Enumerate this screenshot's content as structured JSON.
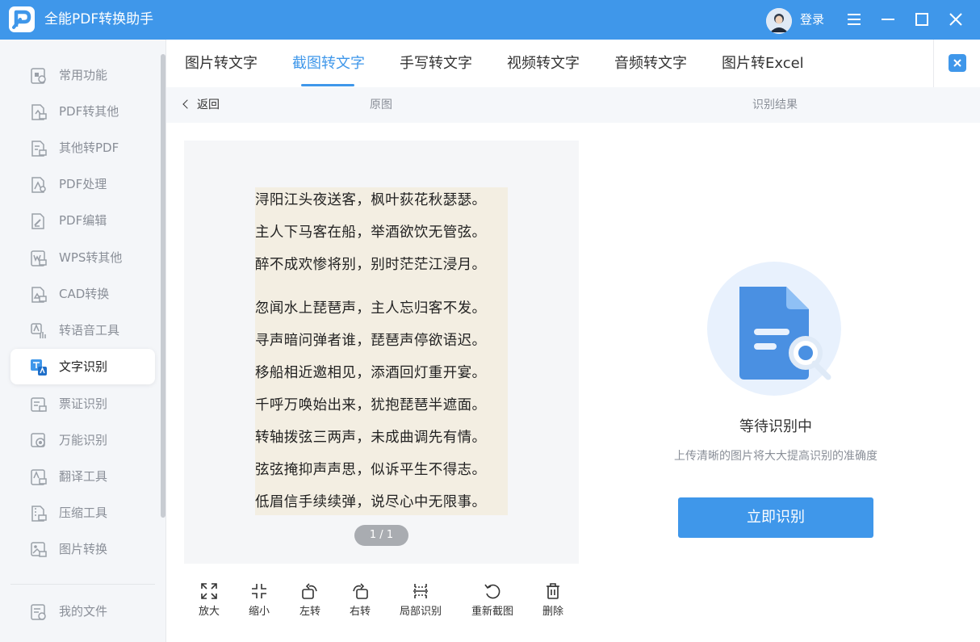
{
  "app": {
    "title": "全能PDF转换助手",
    "login_label": "登录",
    "accent": "#3f97ea"
  },
  "sidebar": {
    "items": [
      {
        "label": "常用功能",
        "icon": "common-icon"
      },
      {
        "label": "PDF转其他",
        "icon": "pdf-convert-icon"
      },
      {
        "label": "其他转PDF",
        "icon": "to-pdf-icon"
      },
      {
        "label": "PDF处理",
        "icon": "pdf-process-icon"
      },
      {
        "label": "PDF编辑",
        "icon": "pdf-edit-icon"
      },
      {
        "label": "WPS转其他",
        "icon": "wps-icon"
      },
      {
        "label": "CAD转换",
        "icon": "cad-icon"
      },
      {
        "label": "转语音工具",
        "icon": "voice-icon"
      },
      {
        "label": "文字识别",
        "icon": "ocr-icon",
        "active": true
      },
      {
        "label": "票证识别",
        "icon": "ticket-icon"
      },
      {
        "label": "万能识别",
        "icon": "universal-icon"
      },
      {
        "label": "翻译工具",
        "icon": "translate-icon"
      },
      {
        "label": "压缩工具",
        "icon": "compress-icon"
      },
      {
        "label": "图片转换",
        "icon": "image-icon"
      }
    ],
    "my_files": "我的文件"
  },
  "tabs": [
    {
      "label": "图片转文字"
    },
    {
      "label": "截图转文字",
      "active": true
    },
    {
      "label": "手写转文字"
    },
    {
      "label": "视频转文字"
    },
    {
      "label": "音频转文字"
    },
    {
      "label": "图片转Excel"
    }
  ],
  "subheader": {
    "back": "返回",
    "original": "原图",
    "result": "识别结果"
  },
  "preview": {
    "lines": [
      "浔阳江头夜送客，枫叶荻花秋瑟瑟。",
      "主人下马客在船，举酒欲饮无管弦。",
      "醉不成欢惨将别，别时茫茫江浸月。",
      "忽闻水上琵琶声，主人忘归客不发。",
      "寻声暗问弹者谁，琵琶声停欲语迟。",
      "移船相近邀相见，添酒回灯重开宴。",
      "千呼万唤始出来，犹抱琵琶半遮面。",
      "转轴拨弦三两声，未成曲调先有情。",
      "弦弦掩抑声声思，似诉平生不得志。",
      "低眉信手续续弹，说尽心中无限事。"
    ],
    "pager": "1 / 1"
  },
  "toolbar": {
    "zoom_in": "放大",
    "zoom_out": "缩小",
    "rotate_left": "左转",
    "rotate_right": "右转",
    "partial": "局部识别",
    "recapture": "重新截图",
    "delete": "删除"
  },
  "result": {
    "status": "等待识别中",
    "tip": "上传清晰的图片将大大提高识别的准确度",
    "button": "立即识别"
  }
}
